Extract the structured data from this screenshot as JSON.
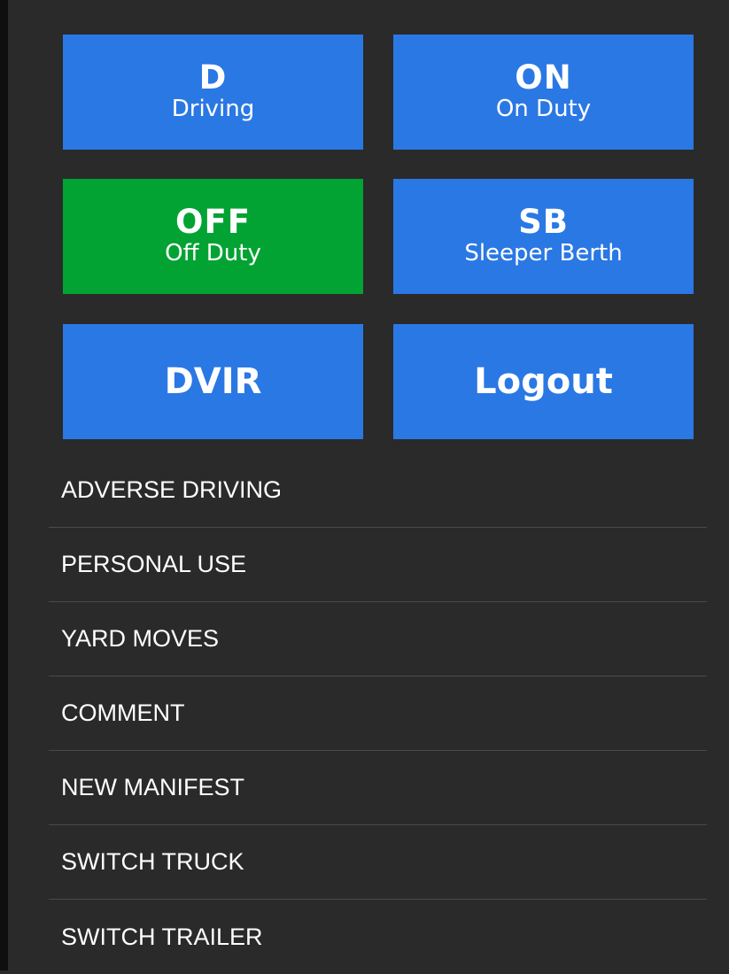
{
  "status_buttons": [
    {
      "code": "D",
      "label": "Driving"
    },
    {
      "code": "ON",
      "label": "On Duty"
    },
    {
      "code": "OFF",
      "label": "Off Duty"
    },
    {
      "code": "SB",
      "label": "Sleeper Berth"
    }
  ],
  "active_status": "OFF",
  "action_buttons": {
    "dvir": "DVIR",
    "logout": "Logout"
  },
  "menu_items": [
    "ADVERSE DRIVING",
    "PERSONAL USE",
    "YARD MOVES",
    "COMMENT",
    "NEW MANIFEST",
    "SWITCH TRUCK",
    "SWITCH TRAILER"
  ],
  "colors": {
    "background": "#2a2a2a",
    "button_blue": "#2a78e4",
    "active_green": "#03a333",
    "divider": "#4a4a4a",
    "text": "#ffffff"
  }
}
